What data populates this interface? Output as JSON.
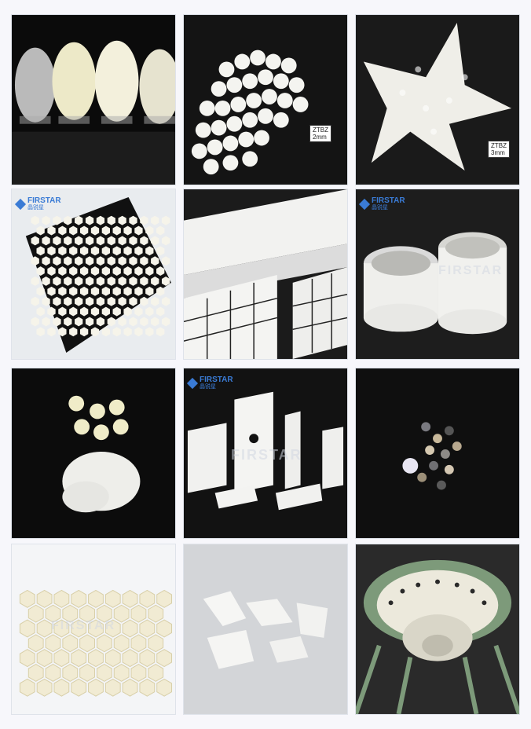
{
  "brand": {
    "name": "FIRSTAR",
    "sub": "晶锐星"
  },
  "labels": {
    "tag_a": "ZTBZ",
    "tag_a2": "2mm",
    "tag_b": "ZTBZ",
    "tag_b2": "3mm"
  },
  "colors": {
    "accent": "#3a7bd5",
    "background": "#f7f7fb",
    "dark": "#121212"
  }
}
